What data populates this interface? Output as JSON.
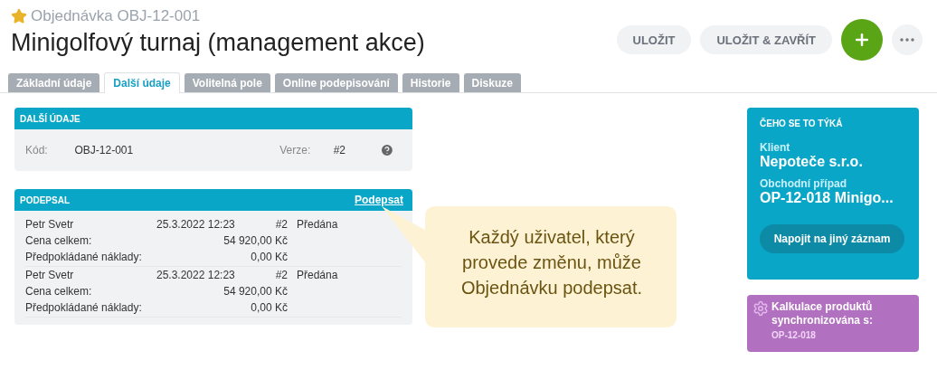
{
  "header": {
    "starred": true,
    "subtitle": "Objednávka OBJ-12-001",
    "title": "Minigolfový turnaj (management akce)"
  },
  "actions": [
    {
      "kind": "text",
      "label": "ULOŽIT"
    },
    {
      "kind": "text",
      "label": "ULOŽIT & ZAVŘÍT"
    },
    {
      "kind": "add"
    },
    {
      "kind": "more"
    }
  ],
  "tabs": [
    {
      "label": "Základní údaje",
      "selected": false
    },
    {
      "label": "Další údaje",
      "selected": true
    },
    {
      "label": "Volitelná pole",
      "selected": false
    },
    {
      "label": "Online podepisování",
      "selected": false
    },
    {
      "label": "Historie",
      "selected": false
    },
    {
      "label": "Diskuze",
      "selected": false
    }
  ],
  "details": {
    "title": "DALŠÍ ÚDAJE",
    "fields": [
      {
        "label": "Kód:",
        "value": "OBJ-12-001"
      },
      {
        "label": "Verze:",
        "value": "#2"
      }
    ]
  },
  "signatures": {
    "title": "PODEPSAL",
    "action": "Podepsat",
    "entries": [
      {
        "name": "Petr Svetr",
        "date": "25.3.2022 12:23",
        "version": "#2",
        "status": "Předána",
        "lines": [
          {
            "label": "Cena celkem:",
            "value": "54 920,00 Kč"
          },
          {
            "label": "Předpokládané náklady:",
            "value": "0,00 Kč"
          }
        ]
      },
      {
        "name": "Petr Svetr",
        "date": "25.3.2022 12:23",
        "version": "#2",
        "status": "Předána",
        "lines": [
          {
            "label": "Cena celkem:",
            "value": "54 920,00 Kč"
          },
          {
            "label": "Předpokládané náklady:",
            "value": "0,00 Kč"
          }
        ]
      }
    ]
  },
  "callout": {
    "text": "Každý uživatel, který provede změnu, může Objednávku podepsat."
  },
  "related": {
    "title": "ČEHO SE TO TÝKÁ",
    "items": [
      {
        "label": "Klient",
        "value": "Nepoteče s.r.o."
      },
      {
        "label": "Obchodní případ",
        "value": "OP-12-018 Minigo..."
      }
    ],
    "button": "Napojit na jiný záznam"
  },
  "sync": {
    "title": "Kalkulace produktů synchronizována s:",
    "reference": "OP-12-018"
  }
}
